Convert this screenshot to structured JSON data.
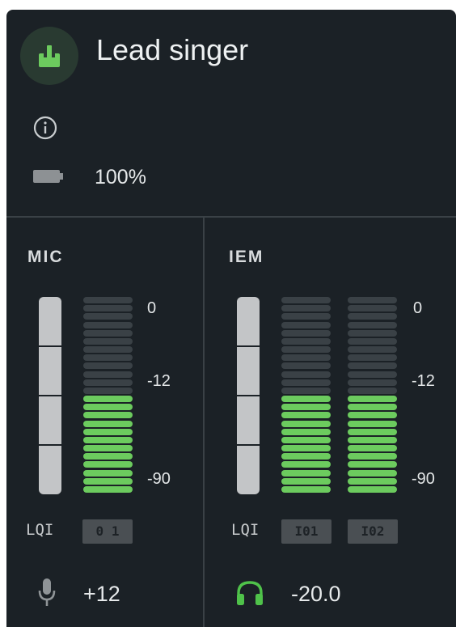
{
  "header": {
    "title": "Lead singer",
    "avatar_icon": "transmitter-icon",
    "info_icon": "info-icon",
    "battery_icon": "battery-icon",
    "battery_level": 1.0,
    "battery_text": "100%"
  },
  "mic": {
    "label": "MIC",
    "fader_level": 1.0,
    "meter": {
      "lit_segments": 12,
      "total_segments": 24
    },
    "scale": [
      "0",
      "-12",
      "-90"
    ],
    "lqi_label": "LQI",
    "lqi_values": [
      "0 1"
    ],
    "footer_icon": "microphone-icon",
    "footer_value": "+12"
  },
  "iem": {
    "label": "IEM",
    "fader_level": 1.0,
    "meters": [
      {
        "lit_segments": 12,
        "total_segments": 24
      },
      {
        "lit_segments": 12,
        "total_segments": 24
      }
    ],
    "scale": [
      "0",
      "-12",
      "-90"
    ],
    "lqi_label": "LQI",
    "lqi_values": [
      "I01",
      "I02"
    ],
    "footer_icon": "headphones-icon",
    "footer_value": "-20.0"
  },
  "colors": {
    "background": "#1b2126",
    "meter_on": "#6ccb5e",
    "meter_off": "#3a4146",
    "accent_green": "#4fc24a",
    "fader": "#c3c5c7"
  }
}
